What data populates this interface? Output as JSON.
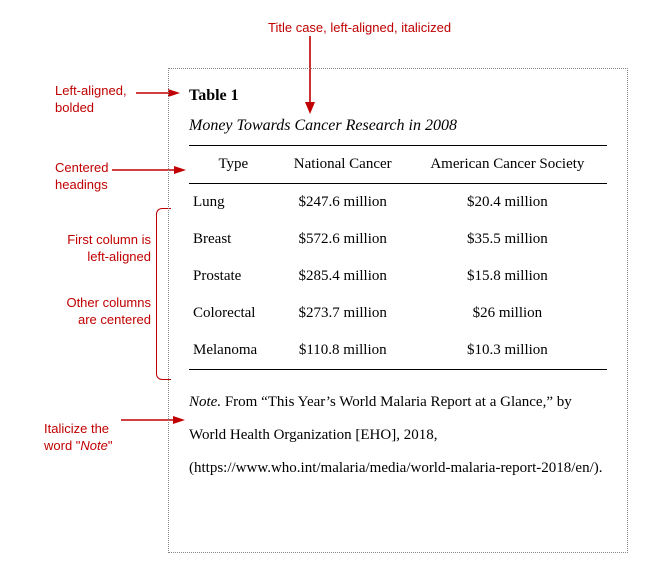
{
  "annotations": {
    "title_note": "Title case, left-aligned, italicized",
    "label_note_l1": "Left-aligned,",
    "label_note_l2": "bolded",
    "headings_note_l1": "Centered",
    "headings_note_l2": "headings",
    "firstcol_note_l1": "First column is",
    "firstcol_note_l2": "left-aligned",
    "othercol_note_l1": "Other columns",
    "othercol_note_l2": "are centered",
    "italicize_note_l1": "Italicize the",
    "italicize_note_l2": "word \"",
    "italicize_note_word": "Note",
    "italicize_note_close": "\""
  },
  "table": {
    "label": "Table 1",
    "title": "Money Towards Cancer Research in 2008",
    "columns": [
      "Type",
      "National Cancer",
      "American Cancer Society"
    ],
    "rows": [
      {
        "type": "Lung",
        "nc": "$247.6 million",
        "acs": "$20.4 million"
      },
      {
        "type": "Breast",
        "nc": "$572.6 million",
        "acs": "$35.5 million"
      },
      {
        "type": "Prostate",
        "nc": "$285.4 million",
        "acs": "$15.8 million"
      },
      {
        "type": "Colorectal",
        "nc": "$273.7 million",
        "acs": "$26 million"
      },
      {
        "type": "Melanoma",
        "nc": "$110.8 million",
        "acs": "$10.3 million"
      }
    ],
    "note_word": "Note.",
    "note_rest": " From “This Year’s World Malaria Report at a Glance,” by World Health Organization [EHO], 2018, (https://www.who.int/malaria/media/world-malaria-report-2018/en/)."
  },
  "chart_data": {
    "type": "table",
    "title": "Money Towards Cancer Research in 2008",
    "columns": [
      "Type",
      "National Cancer",
      "American Cancer Society"
    ],
    "rows": [
      [
        "Lung",
        "$247.6 million",
        "$20.4 million"
      ],
      [
        "Breast",
        "$572.6 million",
        "$35.5 million"
      ],
      [
        "Prostate",
        "$285.4 million",
        "$15.8 million"
      ],
      [
        "Colorectal",
        "$273.7 million",
        "$26 million"
      ],
      [
        "Melanoma",
        "$110.8 million",
        "$10.3 million"
      ]
    ]
  }
}
